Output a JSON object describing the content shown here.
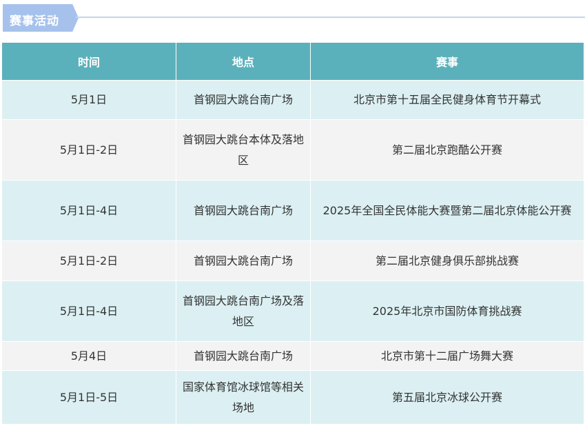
{
  "section": {
    "title": "赛事活动"
  },
  "table": {
    "headers": [
      "时间",
      "地点",
      "赛事"
    ],
    "rows": [
      {
        "time": "5月1日",
        "place": "首钢园大跳台南广场",
        "event": "北京市第十五届全民健身体育节开幕式"
      },
      {
        "time": "5月1日-2日",
        "place": "首钢园大跳台本体及落地区",
        "event": "第二届北京跑酷公开赛"
      },
      {
        "time": "5月1日-4日",
        "place": "首钢园大跳台南广场",
        "event": "2025年全国全民体能大赛暨第二届北京体能公开赛"
      },
      {
        "time": "5月1日-2日",
        "place": "首钢园大跳台南广场",
        "event": "第二届北京健身俱乐部挑战赛"
      },
      {
        "time": "5月1日-4日",
        "place": "首钢园大跳台南广场及落地区",
        "event": "2025年北京市国防体育挑战赛"
      },
      {
        "time": "5月4日",
        "place": "首钢园大跳台南广场",
        "event": "北京市第十二届广场舞大赛"
      },
      {
        "time": "5月1日-5日",
        "place": "国家体育馆冰球馆等相关场地",
        "event": "第五届北京冰球公开赛"
      }
    ]
  }
}
